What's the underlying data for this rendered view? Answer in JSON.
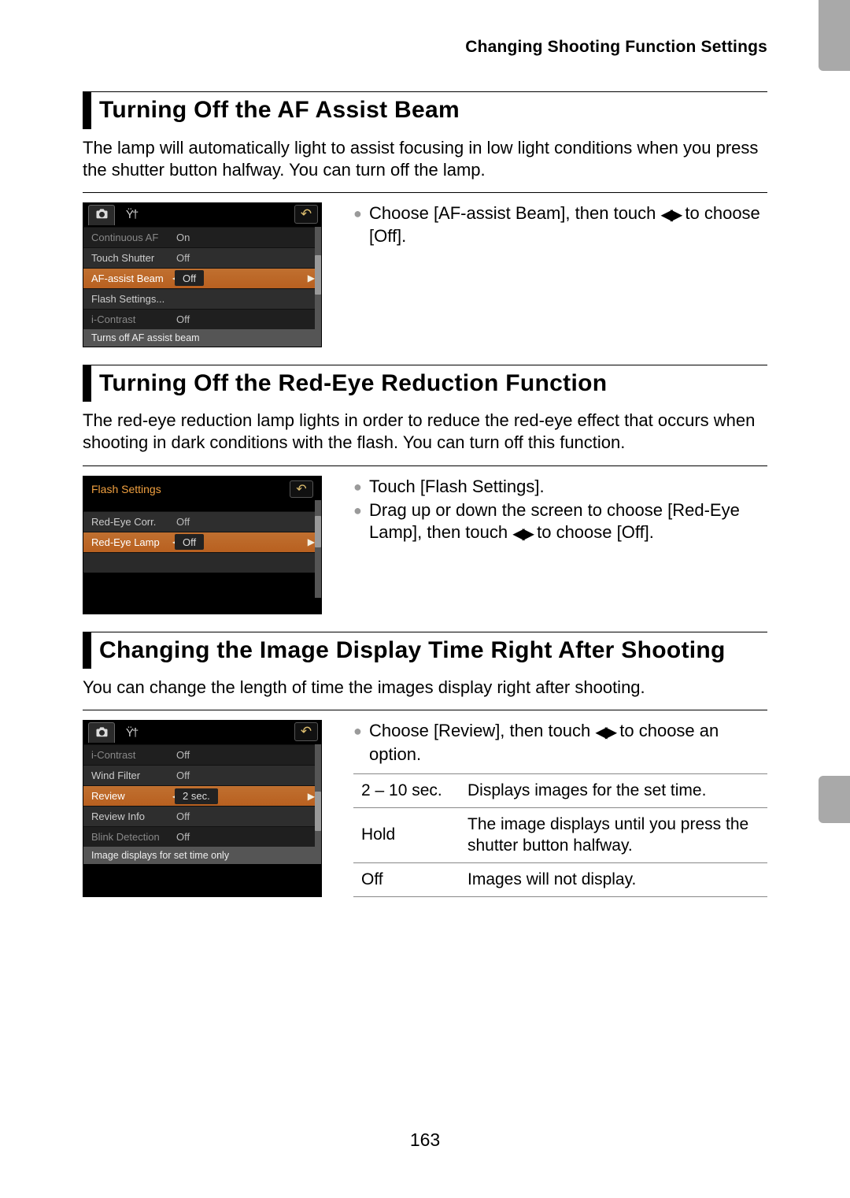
{
  "header": "Changing Shooting Function Settings",
  "page_number": "163",
  "sections": {
    "afbeam": {
      "heading": "Turning Off the AF Assist Beam",
      "para": "The lamp will automatically light to assist focusing in low light conditions when you press the shutter button halfway. You can turn off the lamp.",
      "step1_a": "Choose [AF-assist Beam], then touch ",
      "step1_b": " to choose [Off].",
      "lcd": {
        "row_continuous": "Continuous AF",
        "row_continuous_v": "On",
        "row_touch": "Touch Shutter",
        "row_touch_v": "Off",
        "row_af": "AF-assist Beam",
        "row_af_v": "Off",
        "row_flash": "Flash Settings...",
        "row_icontrast": "i-Contrast",
        "row_icontrast_v": "Off",
        "help": "Turns off AF assist beam"
      }
    },
    "redeye": {
      "heading": "Turning Off the Red-Eye Reduction Function",
      "para": "The red-eye reduction lamp lights in order to reduce the red-eye effect that occurs when shooting in dark conditions with the flash. You can turn off this function.",
      "step1": "Touch [Flash Settings].",
      "step2_a": "Drag up or down the screen to choose [Red-Eye Lamp], then touch ",
      "step2_b": " to choose [Off].",
      "lcd": {
        "title": "Flash Settings",
        "row_corr": "Red-Eye Corr.",
        "row_corr_v": "Off",
        "row_lamp": "Red-Eye Lamp",
        "row_lamp_v": "Off"
      }
    },
    "review": {
      "heading": "Changing the Image Display Time Right After Shooting",
      "para": "You can change the length of time the images display right after shooting.",
      "step1_a": "Choose [Review], then touch ",
      "step1_b": " to choose an option.",
      "lcd": {
        "row_icontrast": "i-Contrast",
        "row_icontrast_v": "Off",
        "row_wind": "Wind Filter",
        "row_wind_v": "Off",
        "row_review": "Review",
        "row_review_v": "2 sec.",
        "row_info": "Review Info",
        "row_info_v": "Off",
        "row_blink": "Blink Detection",
        "row_blink_v": "Off",
        "help": "Image displays for set time only"
      },
      "table": {
        "r1k": "2 – 10 sec.",
        "r1v": "Displays images for the set time.",
        "r2k": "Hold",
        "r2v": "The image displays until you press the shutter button halfway.",
        "r3k": "Off",
        "r3v": "Images will not display."
      }
    }
  }
}
